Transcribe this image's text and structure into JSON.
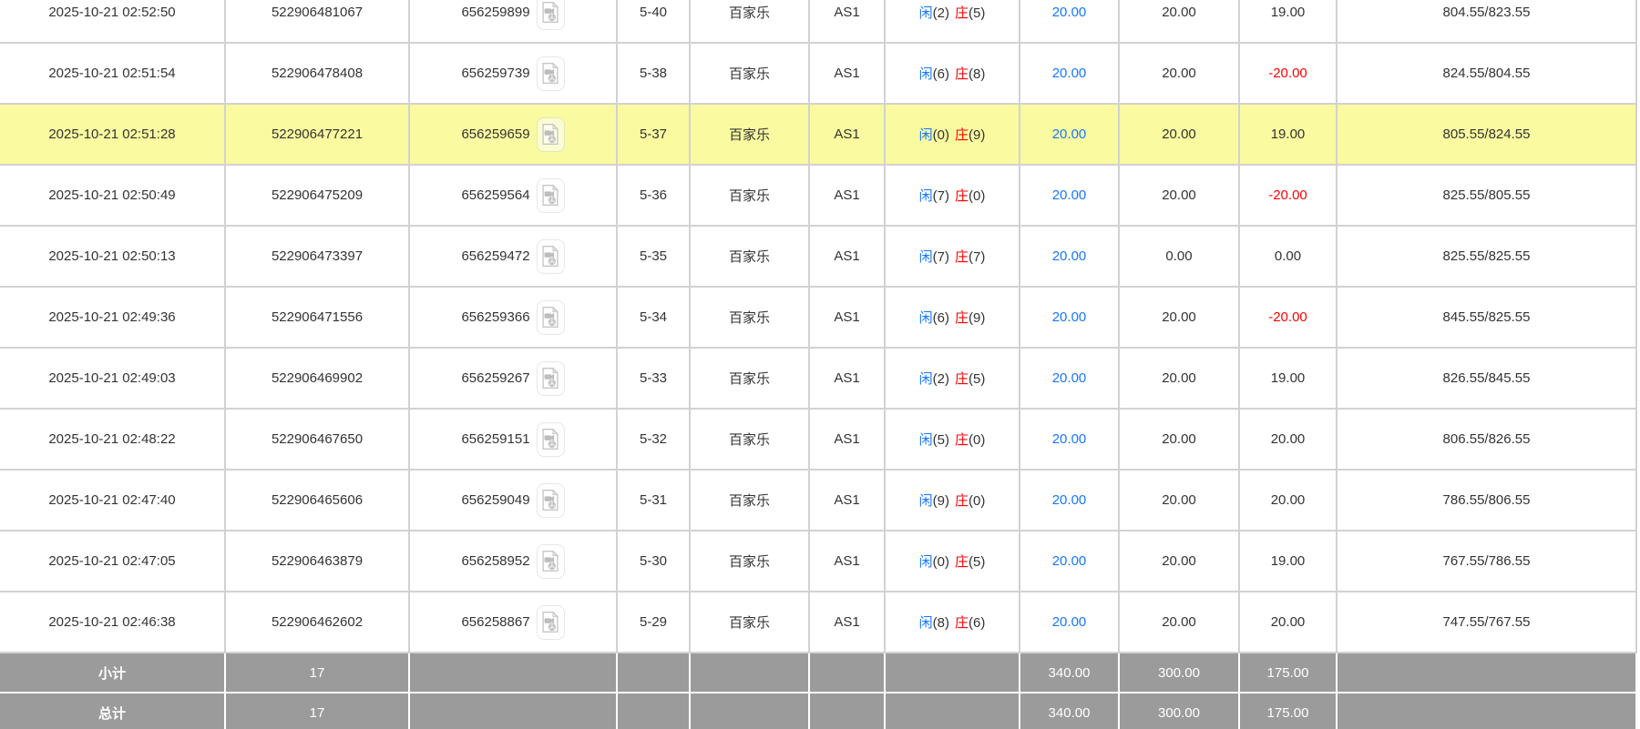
{
  "colors": {
    "highlight_row": "#fafaa0",
    "footer_row_bg": "#9b9b9b",
    "footer_row_text": "#ffffff",
    "link_blue": "#1777ff",
    "player_blue": "#1777ff",
    "banker_red": "#ff0000",
    "negative_red": "#ff0000",
    "grid_border": "#d2d2d2",
    "body_text": "#333333"
  },
  "icons": {
    "video_replay": "video-file-icon"
  },
  "table": {
    "rows": [
      {
        "time": "2025-10-21 02:52:50",
        "order_id": "522906481067",
        "round_id": "656259899",
        "round_no": "5-40",
        "game": "百家乐",
        "table_name": "AS1",
        "player_label": "闲",
        "player_score": "(2)",
        "banker_label": "庄",
        "banker_score": "(5)",
        "bet": "20.00",
        "valid_bet": "20.00",
        "win_loss": "19.00",
        "balance": "804.55/823.55",
        "highlighted": false
      },
      {
        "time": "2025-10-21 02:51:54",
        "order_id": "522906478408",
        "round_id": "656259739",
        "round_no": "5-38",
        "game": "百家乐",
        "table_name": "AS1",
        "player_label": "闲",
        "player_score": "(6)",
        "banker_label": "庄",
        "banker_score": "(8)",
        "bet": "20.00",
        "valid_bet": "20.00",
        "win_loss": "-20.00",
        "balance": "824.55/804.55",
        "highlighted": false
      },
      {
        "time": "2025-10-21 02:51:28",
        "order_id": "522906477221",
        "round_id": "656259659",
        "round_no": "5-37",
        "game": "百家乐",
        "table_name": "AS1",
        "player_label": "闲",
        "player_score": "(0)",
        "banker_label": "庄",
        "banker_score": "(9)",
        "bet": "20.00",
        "valid_bet": "20.00",
        "win_loss": "19.00",
        "balance": "805.55/824.55",
        "highlighted": true
      },
      {
        "time": "2025-10-21 02:50:49",
        "order_id": "522906475209",
        "round_id": "656259564",
        "round_no": "5-36",
        "game": "百家乐",
        "table_name": "AS1",
        "player_label": "闲",
        "player_score": "(7)",
        "banker_label": "庄",
        "banker_score": "(0)",
        "bet": "20.00",
        "valid_bet": "20.00",
        "win_loss": "-20.00",
        "balance": "825.55/805.55",
        "highlighted": false
      },
      {
        "time": "2025-10-21 02:50:13",
        "order_id": "522906473397",
        "round_id": "656259472",
        "round_no": "5-35",
        "game": "百家乐",
        "table_name": "AS1",
        "player_label": "闲",
        "player_score": "(7)",
        "banker_label": "庄",
        "banker_score": "(7)",
        "bet": "20.00",
        "valid_bet": "0.00",
        "win_loss": "0.00",
        "balance": "825.55/825.55",
        "highlighted": false
      },
      {
        "time": "2025-10-21 02:49:36",
        "order_id": "522906471556",
        "round_id": "656259366",
        "round_no": "5-34",
        "game": "百家乐",
        "table_name": "AS1",
        "player_label": "闲",
        "player_score": "(6)",
        "banker_label": "庄",
        "banker_score": "(9)",
        "bet": "20.00",
        "valid_bet": "20.00",
        "win_loss": "-20.00",
        "balance": "845.55/825.55",
        "highlighted": false
      },
      {
        "time": "2025-10-21 02:49:03",
        "order_id": "522906469902",
        "round_id": "656259267",
        "round_no": "5-33",
        "game": "百家乐",
        "table_name": "AS1",
        "player_label": "闲",
        "player_score": "(2)",
        "banker_label": "庄",
        "banker_score": "(5)",
        "bet": "20.00",
        "valid_bet": "20.00",
        "win_loss": "19.00",
        "balance": "826.55/845.55",
        "highlighted": false
      },
      {
        "time": "2025-10-21 02:48:22",
        "order_id": "522906467650",
        "round_id": "656259151",
        "round_no": "5-32",
        "game": "百家乐",
        "table_name": "AS1",
        "player_label": "闲",
        "player_score": "(5)",
        "banker_label": "庄",
        "banker_score": "(0)",
        "bet": "20.00",
        "valid_bet": "20.00",
        "win_loss": "20.00",
        "balance": "806.55/826.55",
        "highlighted": false
      },
      {
        "time": "2025-10-21 02:47:40",
        "order_id": "522906465606",
        "round_id": "656259049",
        "round_no": "5-31",
        "game": "百家乐",
        "table_name": "AS1",
        "player_label": "闲",
        "player_score": "(9)",
        "banker_label": "庄",
        "banker_score": "(0)",
        "bet": "20.00",
        "valid_bet": "20.00",
        "win_loss": "20.00",
        "balance": "786.55/806.55",
        "highlighted": false
      },
      {
        "time": "2025-10-21 02:47:05",
        "order_id": "522906463879",
        "round_id": "656258952",
        "round_no": "5-30",
        "game": "百家乐",
        "table_name": "AS1",
        "player_label": "闲",
        "player_score": "(0)",
        "banker_label": "庄",
        "banker_score": "(5)",
        "bet": "20.00",
        "valid_bet": "20.00",
        "win_loss": "19.00",
        "balance": "767.55/786.55",
        "highlighted": false
      },
      {
        "time": "2025-10-21 02:46:38",
        "order_id": "522906462602",
        "round_id": "656258867",
        "round_no": "5-29",
        "game": "百家乐",
        "table_name": "AS1",
        "player_label": "闲",
        "player_score": "(8)",
        "banker_label": "庄",
        "banker_score": "(6)",
        "bet": "20.00",
        "valid_bet": "20.00",
        "win_loss": "20.00",
        "balance": "747.55/767.55",
        "highlighted": false
      }
    ],
    "footer": [
      {
        "label": "小计",
        "count": "17",
        "bet": "340.00",
        "valid_bet": "300.00",
        "win_loss": "175.00"
      },
      {
        "label": "总计",
        "count": "17",
        "bet": "340.00",
        "valid_bet": "300.00",
        "win_loss": "175.00"
      }
    ]
  }
}
